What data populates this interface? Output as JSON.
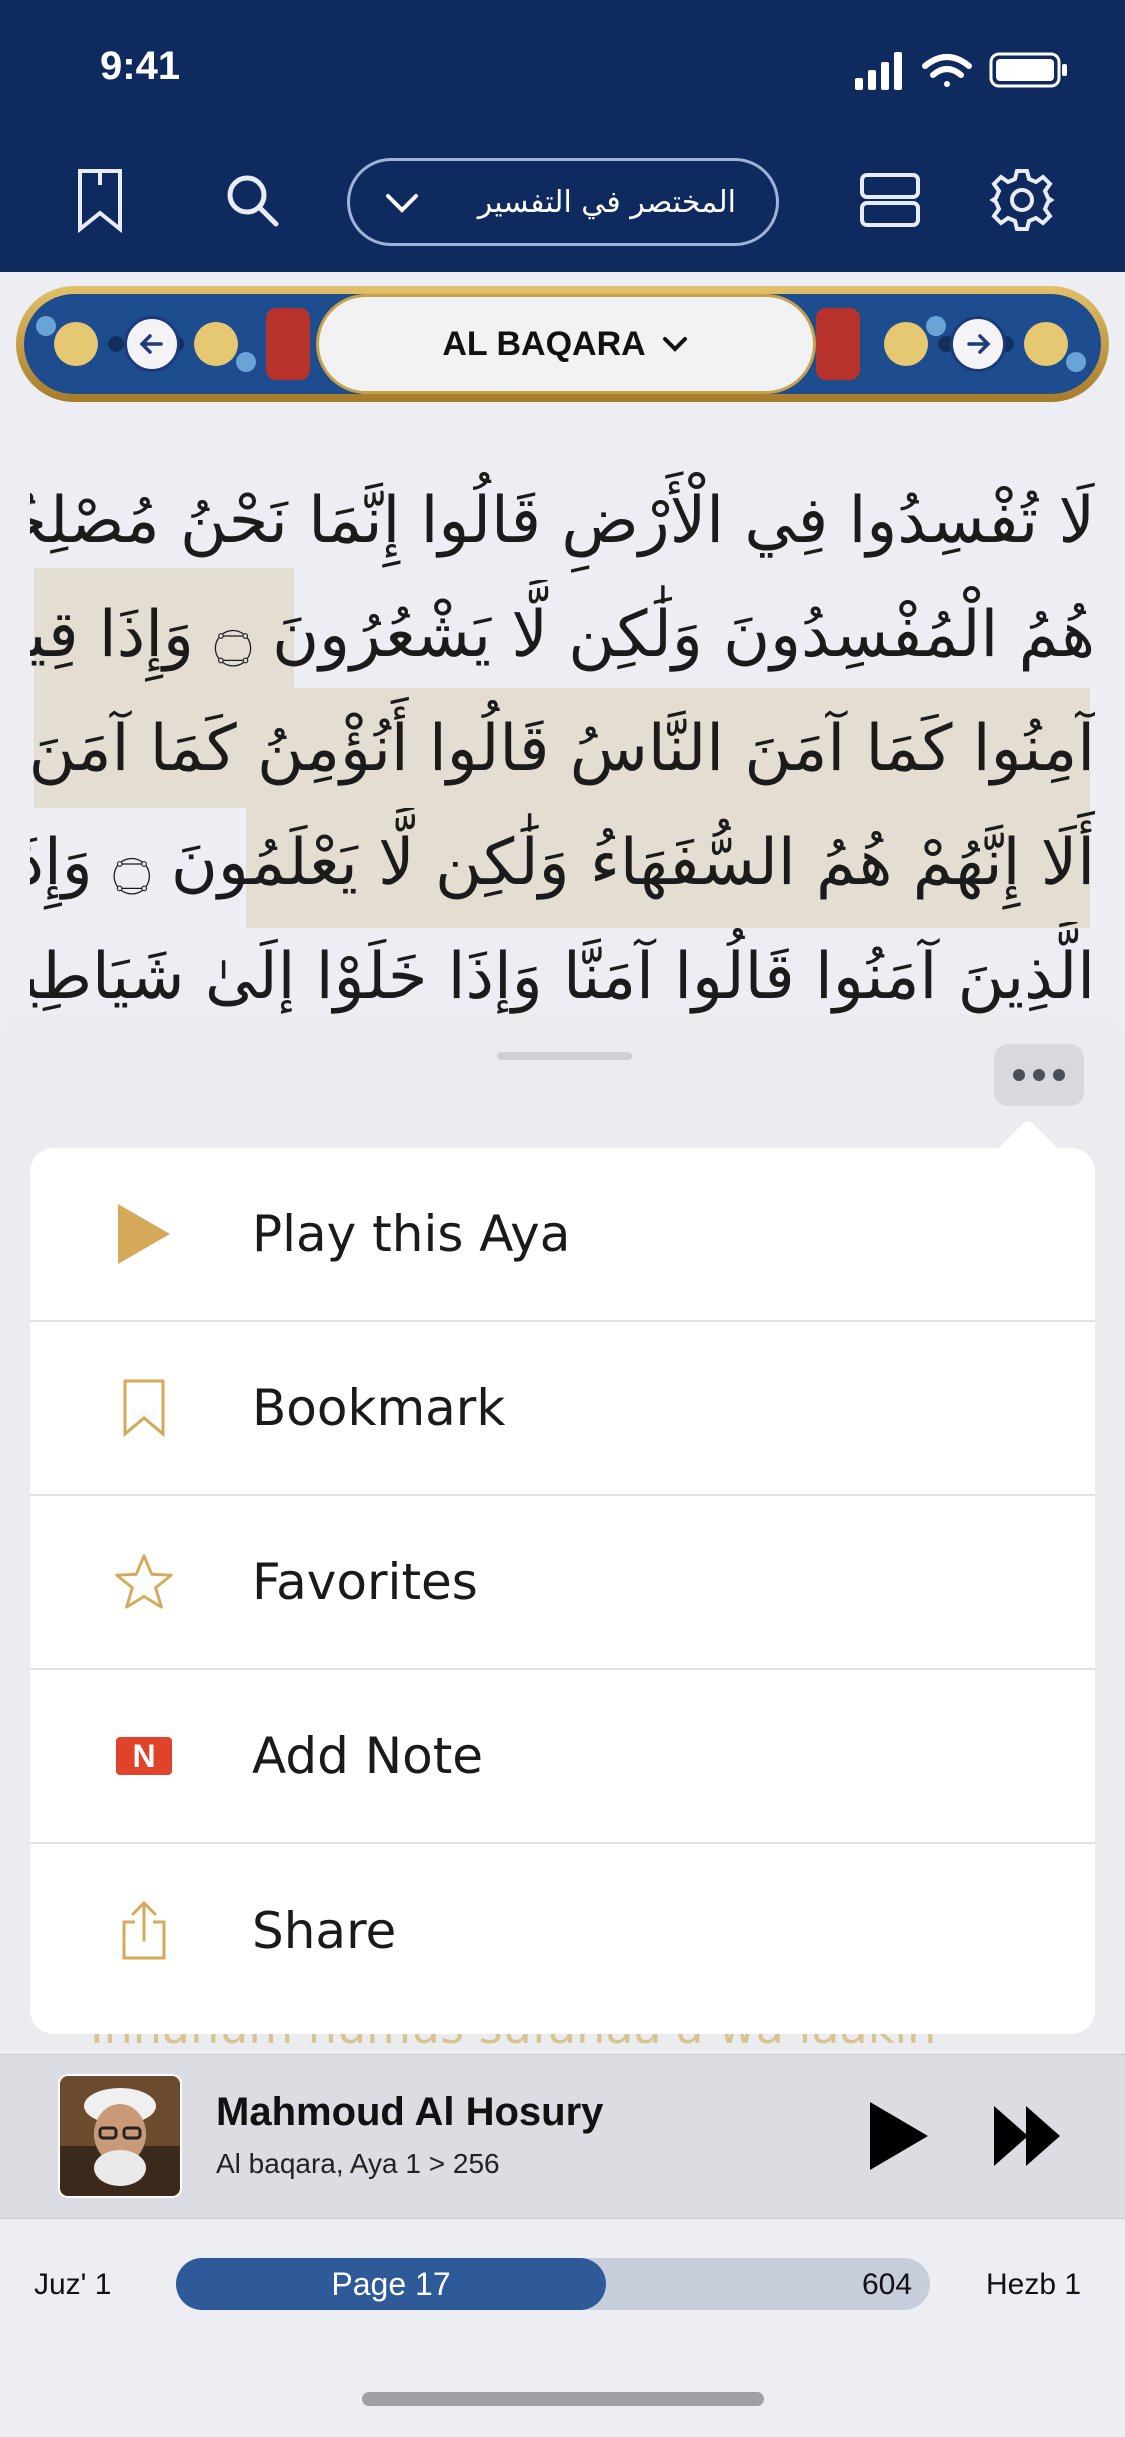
{
  "status_bar": {
    "time": "9:41"
  },
  "header": {
    "tafsir_selector": "المختصر في التفسير",
    "icons": [
      "bookmark-icon",
      "search-icon",
      "chevron-down-icon",
      "layout-icon",
      "gear-icon"
    ],
    "colors": {
      "background": "#0f2a5f"
    }
  },
  "surah_header": {
    "title": "AL BAQARA",
    "prev": "arrow-left-icon",
    "next": "arrow-right-icon"
  },
  "quran_lines": [
    "لَا تُفْسِدُوا فِي الْأَرْضِ قَالُوا إِنَّمَا نَحْنُ مُصْلِحُونَ ۝ أَلَا إِنَّهُمْ",
    "هُمُ الْمُفْسِدُونَ وَلَٰكِن لَّا يَشْعُرُونَ ۝ وَإِذَا قِيلَ لَهُمْ",
    "آمِنُوا كَمَا آمَنَ النَّاسُ قَالُوا أَنُؤْمِنُ كَمَا آمَنَ السُّفَهَاءُ",
    "أَلَا إِنَّهُمْ هُمُ السُّفَهَاءُ وَلَٰكِن لَّا يَعْلَمُونَ ۝ وَإِذَا لَقُوا",
    "الَّذِينَ آمَنُوا قَالُوا آمَنَّا وَإِذَا خَلَوْا إِلَىٰ شَيَاطِينِهِمْ قَالُوا إِنَّا"
  ],
  "menu": {
    "items": [
      {
        "label": "Play this Aya",
        "icon": "play-icon"
      },
      {
        "label": "Bookmark",
        "icon": "bookmark-icon"
      },
      {
        "label": "Favorites",
        "icon": "star-icon"
      },
      {
        "label": "Add Note",
        "icon": "note-icon",
        "badge": "N"
      },
      {
        "label": "Share",
        "icon": "share-icon"
      }
    ],
    "accent": "#d4aa5a"
  },
  "peek_text": "Innahum humus sufahaa'u wa laakin",
  "player": {
    "reciter": "Mahmoud Al Hosury",
    "subtitle": "Al baqara, Aya 1 > 256"
  },
  "page_bar": {
    "juz": "Juz' 1",
    "hezb": "Hezb 1",
    "current_page": "Page 17",
    "total_pages": "604",
    "progress": 0.57
  }
}
